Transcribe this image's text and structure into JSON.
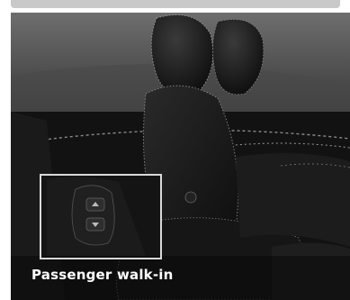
{
  "caption": "Passenger walk-in",
  "colors": {
    "background": "#ffffff",
    "leather_dark": "#141414",
    "headliner": "#5a5a5a",
    "caption_text": "#ffffff",
    "inset_border": "#d9d9d9"
  },
  "icons": {
    "inset": "seat-control-switch",
    "scene": "car-front-passenger-seat"
  }
}
